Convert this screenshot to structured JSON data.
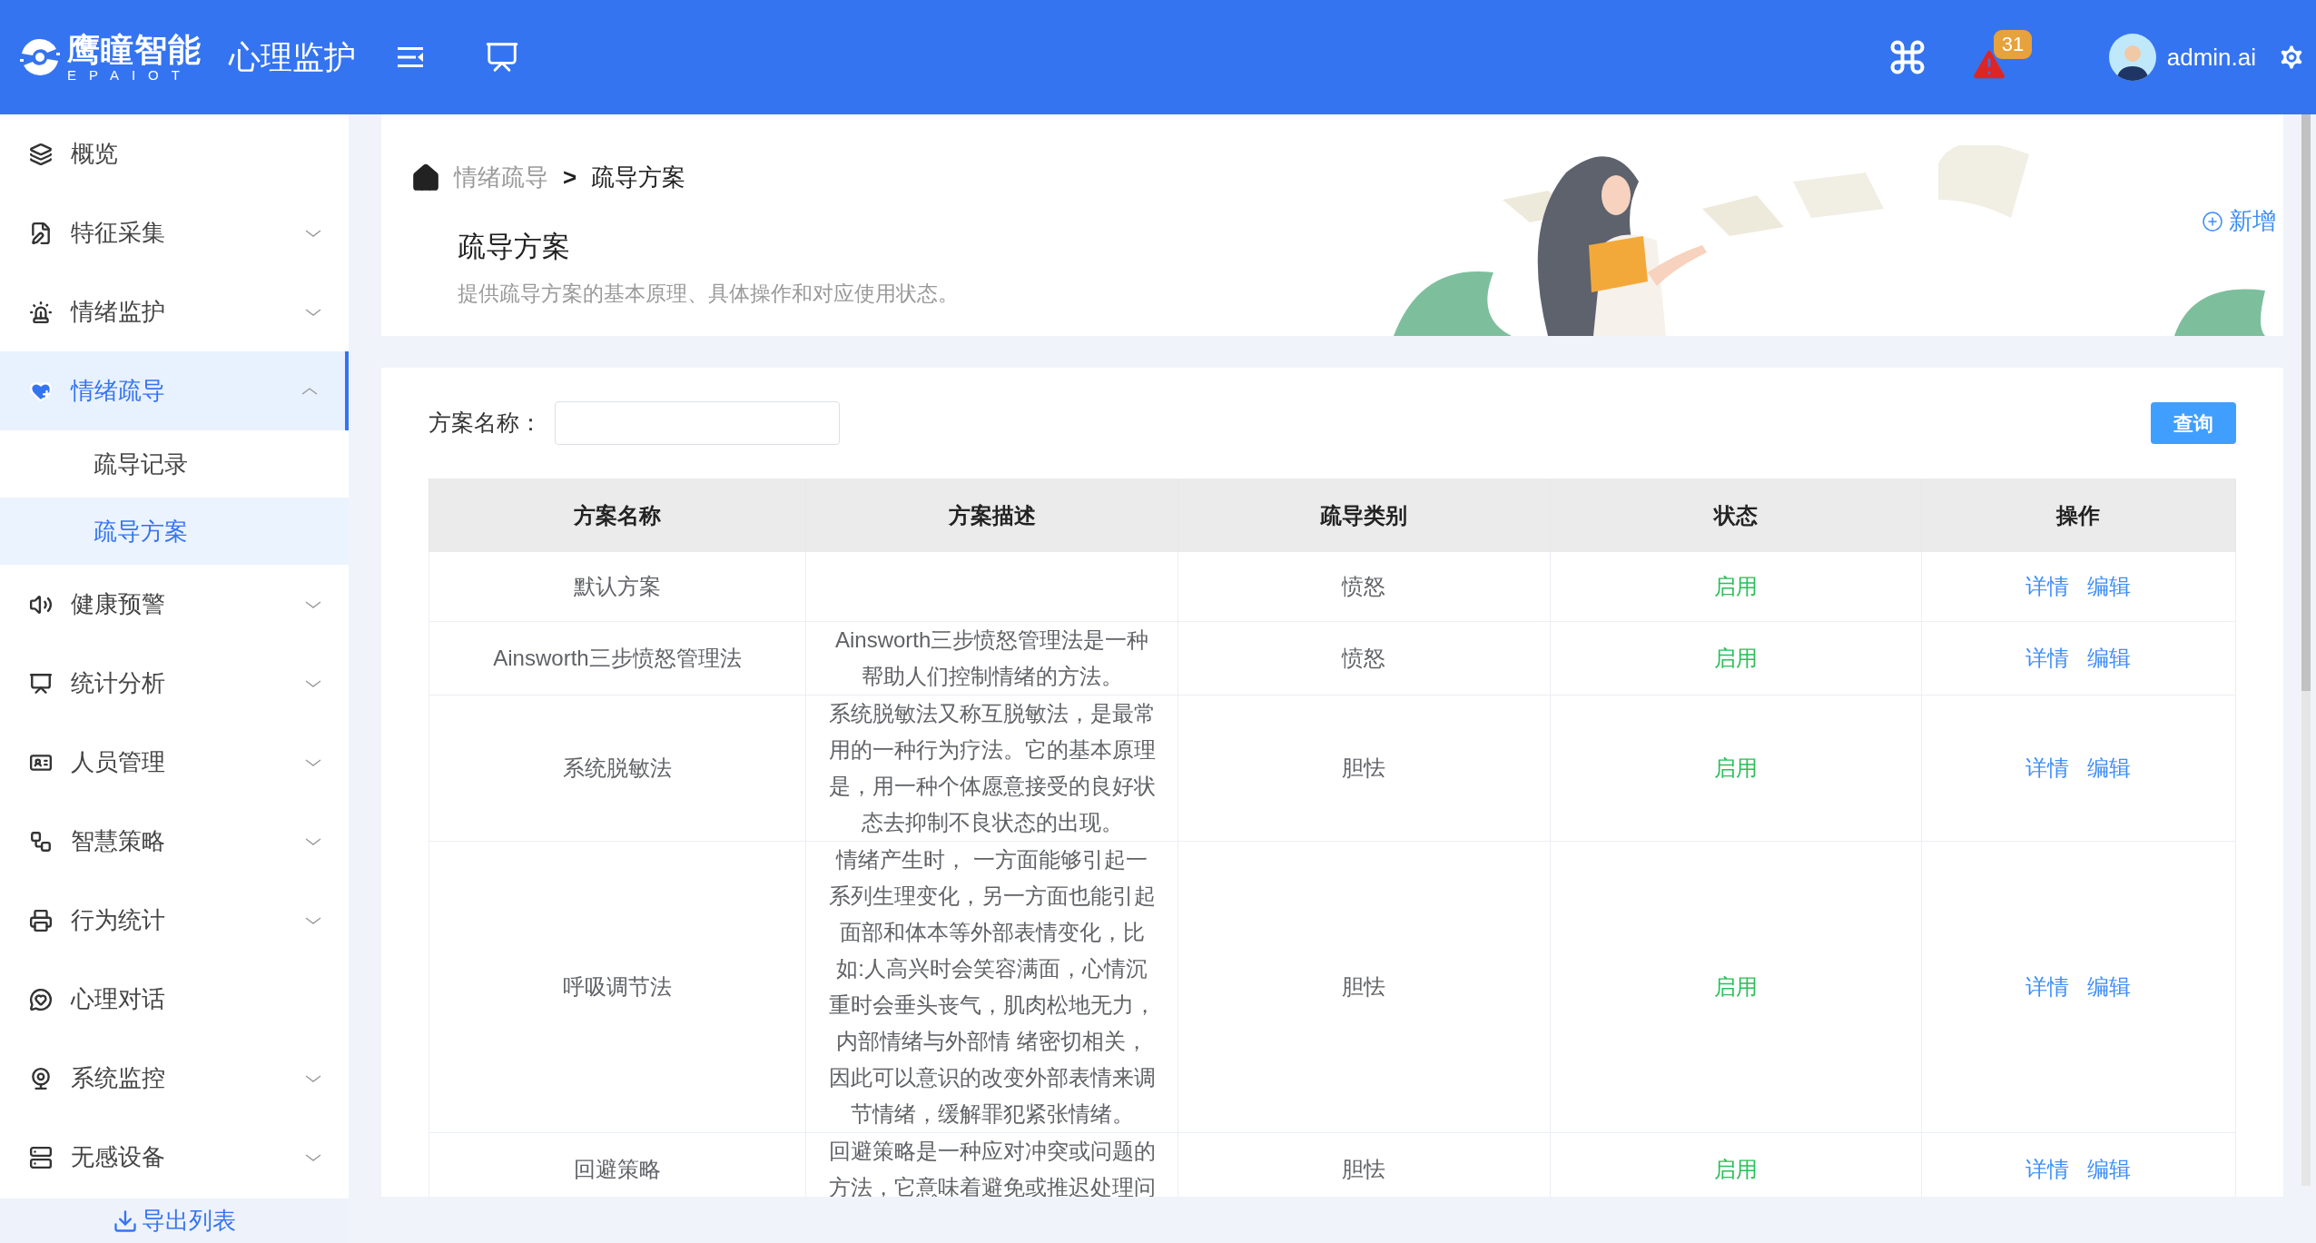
{
  "header": {
    "logo": {
      "name": "鹰瞳智能",
      "subtitle": "EPAIOT"
    },
    "app_title": "心理监护",
    "notification_count": "31",
    "user_name": "admin.ai"
  },
  "sidebar": {
    "items": [
      {
        "label": "概览",
        "expandable": false,
        "selected": false
      },
      {
        "label": "特征采集",
        "expandable": true,
        "expanded": false,
        "selected": false
      },
      {
        "label": "情绪监护",
        "expandable": true,
        "expanded": false,
        "selected": false
      },
      {
        "label": "情绪疏导",
        "expandable": true,
        "expanded": true,
        "selected": true,
        "children": [
          {
            "label": "疏导记录",
            "selected": false
          },
          {
            "label": "疏导方案",
            "selected": true
          }
        ]
      },
      {
        "label": "健康预警",
        "expandable": true,
        "expanded": false,
        "selected": false
      },
      {
        "label": "统计分析",
        "expandable": true,
        "expanded": false,
        "selected": false
      },
      {
        "label": "人员管理",
        "expandable": true,
        "expanded": false,
        "selected": false
      },
      {
        "label": "智慧策略",
        "expandable": true,
        "expanded": false,
        "selected": false
      },
      {
        "label": "行为统计",
        "expandable": true,
        "expanded": false,
        "selected": false
      },
      {
        "label": "心理对话",
        "expandable": false,
        "selected": false
      },
      {
        "label": "系统监控",
        "expandable": true,
        "expanded": false,
        "selected": false
      },
      {
        "label": "无感设备",
        "expandable": true,
        "expanded": false,
        "selected": false
      }
    ],
    "export_link": "导出列表"
  },
  "breadcrumb": {
    "items": [
      "情绪疏导",
      "疏导方案"
    ],
    "separator": ">"
  },
  "page": {
    "title": "疏导方案",
    "description": "提供疏导方案的基本原理、具体操作和对应使用状态。",
    "add_button": "新增"
  },
  "filter": {
    "label": "方案名称：",
    "query_button": "查询"
  },
  "table": {
    "columns": [
      "方案名称",
      "方案描述",
      "疏导类别",
      "状态",
      "操作"
    ],
    "rows": [
      {
        "name": "默认方案",
        "description": "",
        "category": "愤怒",
        "status": "启用",
        "actions": [
          "详情",
          "编辑"
        ]
      },
      {
        "name": "Ainsworth三步愤怒管理法",
        "description": "Ainsworth三步愤怒管理法是一种帮助人们控制情绪的方法。",
        "category": "愤怒",
        "status": "启用",
        "actions": [
          "详情",
          "编辑"
        ]
      },
      {
        "name": "系统脱敏法",
        "description": "系统脱敏法又称互脱敏法，是最常用的一种行为疗法。它的基本原理是，用一种个体愿意接受的良好状态去抑制不良状态的出现。",
        "category": "胆怯",
        "status": "启用",
        "actions": [
          "详情",
          "编辑"
        ]
      },
      {
        "name": "呼吸调节法",
        "description": "情绪产生时， 一方面能够引起一系列生理变化，另一方面也能引起面部和体本等外部表情变化，比如:人高兴时会笑容满面，心情沉重时会垂头丧气，肌肉松地无力，内部情绪与外部情 绪密切相关，因此可以意识的改变外部表情来调节情绪，缓解罪犯紧张情绪。",
        "category": "胆怯",
        "status": "启用",
        "actions": [
          "详情",
          "编辑"
        ]
      },
      {
        "name": "回避策略",
        "description": "回避策略是一种应对冲突或问题的方法，它意味着避免或推迟处理问",
        "category": "胆怯",
        "status": "启用",
        "actions": [
          "详情",
          "编辑"
        ]
      }
    ]
  }
}
